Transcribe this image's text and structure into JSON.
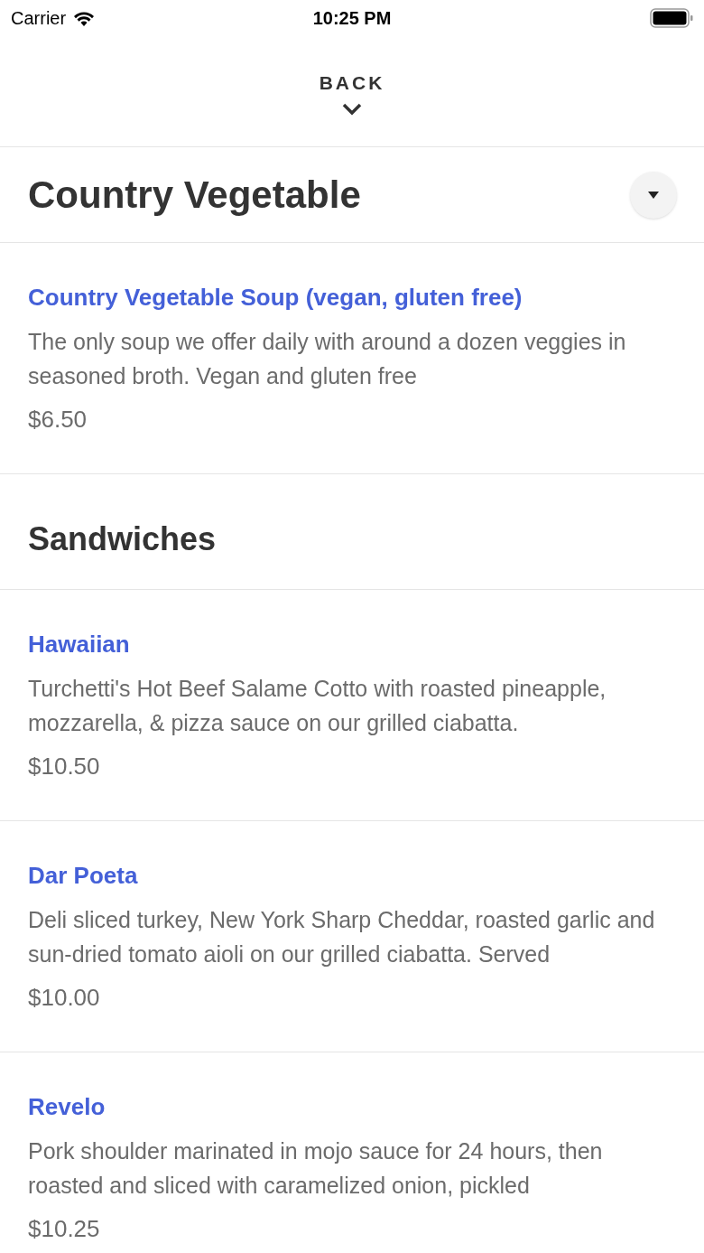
{
  "status_bar": {
    "carrier": "Carrier",
    "time": "10:25 PM"
  },
  "back_label": "BACK",
  "header": {
    "title": "Country Vegetable"
  },
  "menu": [
    {
      "kind": "item",
      "name": "Country Vegetable Soup (vegan, gluten free)",
      "description": "The only soup we offer daily with around a dozen veggies in seasoned broth. Vegan and gluten free",
      "price": "$6.50"
    },
    {
      "kind": "section",
      "title": "Sandwiches"
    },
    {
      "kind": "item",
      "name": "Hawaiian",
      "description": "Turchetti's Hot Beef Salame Cotto with roasted pineapple, mozzarella, & pizza sauce on our grilled ciabatta.",
      "price": "$10.50"
    },
    {
      "kind": "item",
      "name": "Dar Poeta",
      "description": "Deli sliced turkey, New York Sharp Cheddar, roasted garlic and sun-dried tomato aioli on our grilled ciabatta. Served",
      "price": "$10.00"
    },
    {
      "kind": "item",
      "name": "Revelo",
      "description": "Pork shoulder marinated in mojo sauce for 24 hours, then roasted and sliced with caramelized onion, pickled",
      "price": "$10.25"
    }
  ]
}
